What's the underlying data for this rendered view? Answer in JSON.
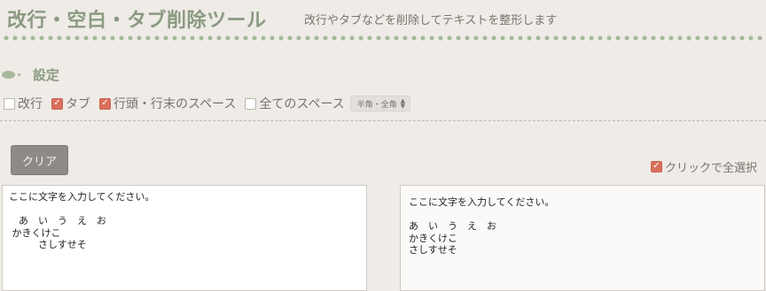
{
  "header": {
    "title": "改行・空白・タブ削除ツール",
    "subtitle": "改行やタブなどを削除してテキストを整形します"
  },
  "settings": {
    "heading": "設定",
    "options": [
      {
        "label": "改行",
        "checked": false
      },
      {
        "label": "タブ",
        "checked": true
      },
      {
        "label": "行頭・行末のスペース",
        "checked": true
      },
      {
        "label": "全てのスペース",
        "checked": false
      }
    ],
    "space_width_select": {
      "value": "半角・全角"
    }
  },
  "actions": {
    "clear_label": "クリア",
    "select_all_label": "クリックで全選択",
    "select_all_checked": true
  },
  "input_panel": {
    "text": "ここに文字を入力してください。\n\n　あ　い　う　え　お\n かきくけこ\n　　　さしすせそ"
  },
  "output_panel": {
    "text": "ここに文字を入力してください。\n\nあ　い　う　え　お\nかきくけこ\nさしすせそ"
  },
  "colors": {
    "background": "#efebe6",
    "accent_green": "#8a9a82",
    "checkbox_checked": "#d9705c",
    "button_gray": "#8e8b87"
  }
}
